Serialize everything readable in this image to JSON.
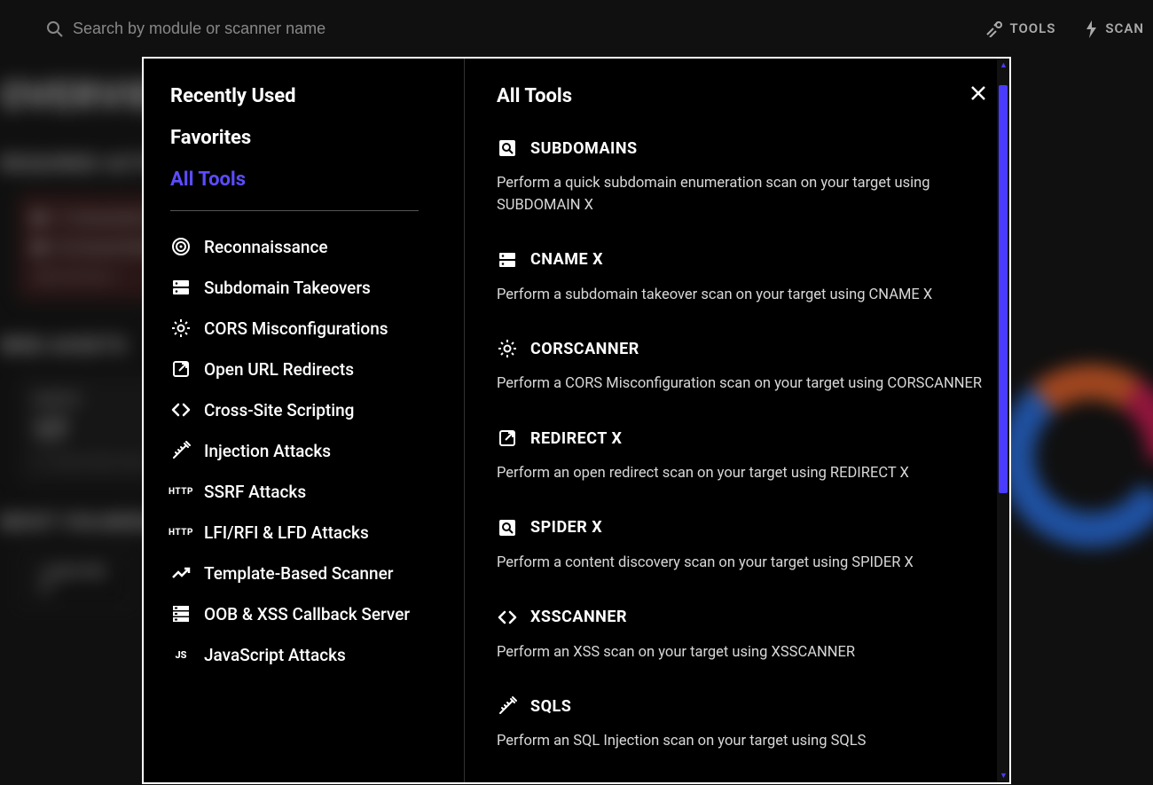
{
  "topbar": {
    "search_placeholder": "Search by module or scanner name",
    "tools_label": "TOOLS",
    "scan_label": "SCAN"
  },
  "background": {
    "title": "OVERVIEW",
    "req_actions": "REQUIRED ACTIONS",
    "line1": "11 Unresolved Vulnerabilities",
    "line2": "22 Unread Notifications",
    "view_all": "View all now  >",
    "web_assets": "WEB ASSETS",
    "hosts": "HOSTS",
    "hosts_n": "17",
    "hosts_sub": "+1  since last scan",
    "most_vuln": "MOST VULNERABLE TARGETS",
    "lab": "*.LAB.XT.RS",
    "lab_n": "17"
  },
  "modal": {
    "nav": {
      "recent": "Recently Used",
      "favorites": "Favorites",
      "all": "All Tools"
    },
    "categories": [
      {
        "icon": "target",
        "label": "Reconnaissance"
      },
      {
        "icon": "dns",
        "label": "Subdomain Takeovers"
      },
      {
        "icon": "gear",
        "label": "CORS Misconfigurations"
      },
      {
        "icon": "open",
        "label": "Open URL Redirects"
      },
      {
        "icon": "code",
        "label": "Cross-Site Scripting"
      },
      {
        "icon": "syringe",
        "label": "Injection Attacks"
      },
      {
        "icon": "http",
        "label": "SSRF Attacks"
      },
      {
        "icon": "http",
        "label": "LFI/RFI & LFD Attacks"
      },
      {
        "icon": "chart",
        "label": "Template-Based Scanner"
      },
      {
        "icon": "storage",
        "label": "OOB & XSS Callback Server"
      },
      {
        "icon": "js",
        "label": "JavaScript Attacks"
      }
    ],
    "right_title": "All Tools",
    "tools": [
      {
        "icon": "pageview",
        "name": "SUBDOMAINS",
        "desc": "Perform a quick subdomain enumeration scan on your target using SUBDOMAIN X"
      },
      {
        "icon": "dns",
        "name": "CNAME X",
        "desc": "Perform a subdomain takeover scan on your target using CNAME X"
      },
      {
        "icon": "gear",
        "name": "CORSCANNER",
        "desc": "Perform a CORS Misconfiguration scan on your target using CORSCANNER"
      },
      {
        "icon": "open",
        "name": "REDIRECT X",
        "desc": "Perform an open redirect scan on your target using REDIRECT X"
      },
      {
        "icon": "pageview",
        "name": "SPIDER X",
        "desc": "Perform a content discovery scan on your target using SPIDER X"
      },
      {
        "icon": "code",
        "name": "XSSCANNER",
        "desc": "Perform an XSS scan on your target using XSSCANNER"
      },
      {
        "icon": "syringe",
        "name": "SQLS",
        "desc": "Perform an SQL Injection scan on your target using SQLS"
      }
    ]
  }
}
